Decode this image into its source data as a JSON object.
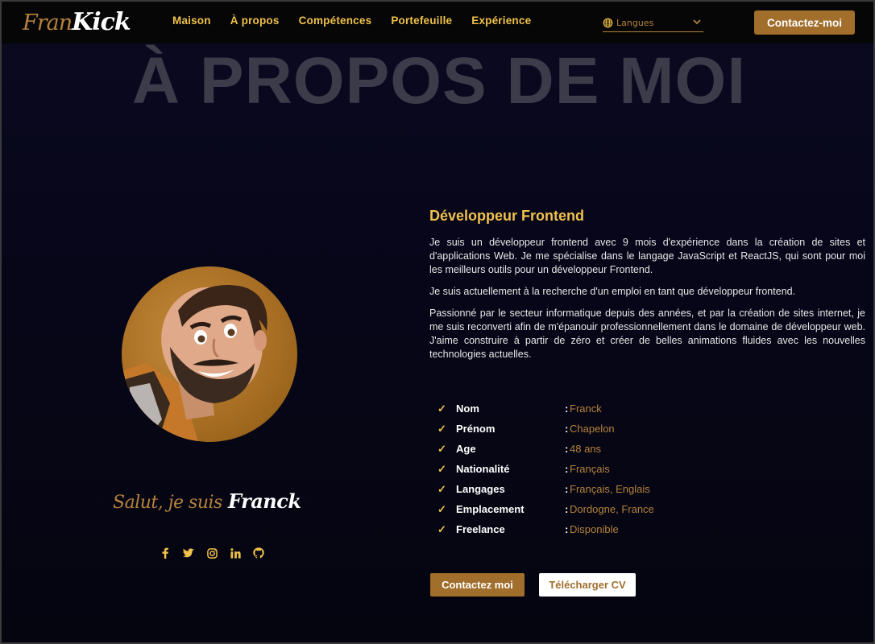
{
  "brand": {
    "part1": "Fran",
    "part2": "Kick"
  },
  "nav": {
    "links": [
      {
        "label": "Maison"
      },
      {
        "label": "À propos"
      },
      {
        "label": "Compétences"
      },
      {
        "label": "Portefeuille"
      },
      {
        "label": "Expérience"
      }
    ],
    "language": {
      "label": "Langues",
      "icon": "globe-icon"
    },
    "contact_label": "Contactez-moi"
  },
  "section_title": "À PROPOS DE MOI",
  "profile": {
    "greeting_prefix": "Salut, je suis",
    "greeting_name": "Franck",
    "socials": [
      "facebook-icon",
      "twitter-icon",
      "instagram-icon",
      "linkedin-icon",
      "github-icon"
    ]
  },
  "about": {
    "role": "Développeur Frontend",
    "paragraphs": [
      "Je suis un développeur frontend avec 9 mois d'expérience dans la création de sites et d'applications Web. Je me spécialise dans le langage JavaScript et ReactJS, qui sont pour moi les meilleurs outils pour un développeur Frontend.",
      "Je suis actuellement à la recherche d'un emploi en tant que développeur frontend.",
      "Passionné par le secteur informatique depuis des années, et par la création de sites internet, je me suis reconverti afin de m'épanouir professionnellement dans le domaine de développeur web. J'aime construire à partir de zéro et créer de belles animations fluides avec les nouvelles technologies actuelles."
    ],
    "info": [
      {
        "key": "Nom",
        "value": "Franck"
      },
      {
        "key": "Prénom",
        "value": "Chapelon"
      },
      {
        "key": "Age",
        "value": "48 ans"
      },
      {
        "key": "Nationalité",
        "value": "Français"
      },
      {
        "key": "Langages",
        "value": "Français, Englais"
      },
      {
        "key": "Emplacement",
        "value": "Dordogne, France"
      },
      {
        "key": "Freelance",
        "value": "Disponible"
      }
    ],
    "check_mark": "✓",
    "separator": ":",
    "buttons": {
      "contact": "Contactez moi",
      "cv": "Télécharger CV"
    }
  },
  "colors": {
    "accent": "#f0c14b",
    "brown": "#a16e2c",
    "value_text": "#b5823c",
    "background": "#07061a"
  }
}
